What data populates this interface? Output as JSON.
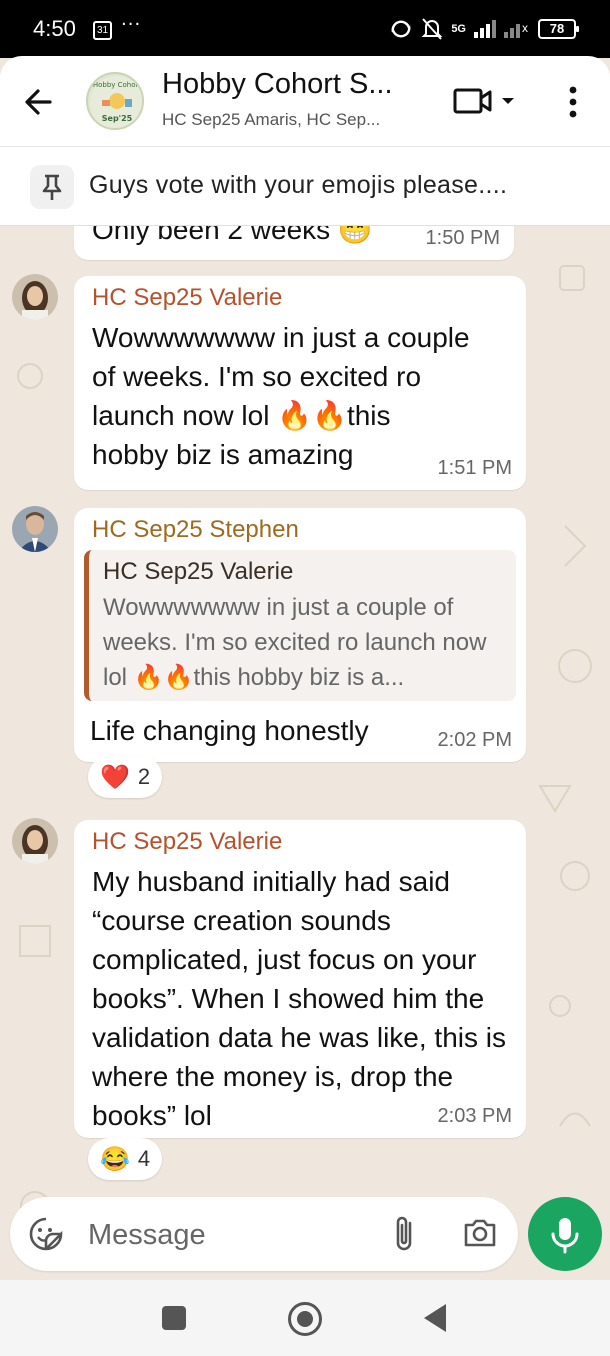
{
  "status_bar": {
    "time": "4:50",
    "calendar_day": "31",
    "more": "···",
    "network": "5G",
    "battery": "78"
  },
  "header": {
    "back_icon": "arrow-left-icon",
    "avatar_text_1": "Hobby Cohort",
    "avatar_text_2": "Sep'25",
    "title": "Hobby Cohort S...",
    "subtitle": "HC Sep25 Amaris, HC Sep...",
    "video_icon": "video-camera-icon",
    "more_icon": "more-vertical-icon"
  },
  "pinned": {
    "icon": "pin-icon",
    "text": "Guys vote with your emojis please...."
  },
  "messages": [
    {
      "type": "partial",
      "text": "Only been 2 weeks 😁",
      "time": "1:50 PM"
    },
    {
      "sender": "HC Sep25 Valerie",
      "sender_color": "#b5512b",
      "text": "Wowwwwwww in just a couple of weeks. I'm so excited ro launch now lol 🔥🔥this hobby biz is amazing",
      "time": "1:51 PM"
    },
    {
      "sender": "HC Sep25 Stephen",
      "sender_color": "#9d6a1f",
      "quote_sender": "HC Sep25 Valerie",
      "quote_text": "Wowwwwwww in just a couple of weeks. I'm so excited ro launch now lol 🔥🔥this hobby biz is a...",
      "text": "Life changing honestly",
      "time": "2:02 PM",
      "reaction_emoji": "❤️",
      "reaction_count": "2"
    },
    {
      "sender": "HC Sep25 Valerie",
      "sender_color": "#b5512b",
      "text": "My husband initially had said “course creation sounds complicated, just focus on your books”. When I showed him the validation data he was like, this is where the money is, drop the books” lol",
      "time": "2:03 PM",
      "reaction_emoji": "😂",
      "reaction_count": "4"
    }
  ],
  "composer": {
    "emoji_icon": "sticker-icon",
    "placeholder": "Message",
    "attach_icon": "paperclip-icon",
    "camera_icon": "camera-icon",
    "mic_icon": "microphone-icon"
  },
  "colors": {
    "accent_green": "#1aa561",
    "chat_bg": "#efe7dd",
    "quote_bar": "#b35a2c"
  }
}
